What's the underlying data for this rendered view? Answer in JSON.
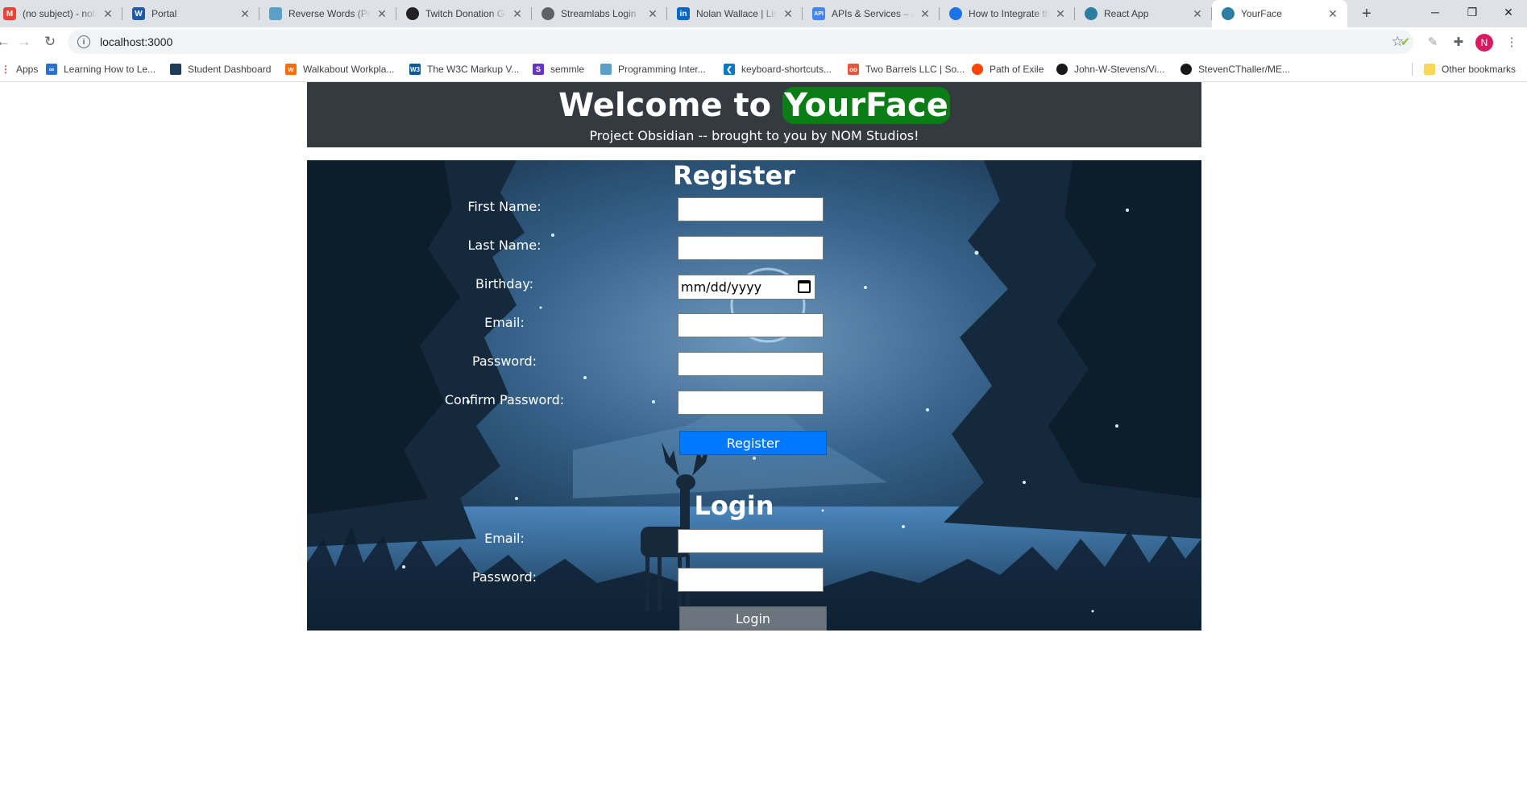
{
  "browser": {
    "tabs": [
      {
        "title": "(no subject) - nolan",
        "favicon": "gmail-icon",
        "color": "#ea4335"
      },
      {
        "title": "Portal",
        "favicon": "portal-w-icon",
        "color": "#1e5aa8"
      },
      {
        "title": "Reverse Words (Pra",
        "favicon": "book-icon",
        "color": "#5aa0c8"
      },
      {
        "title": "Twitch Donation Go",
        "favicon": "streamlabs-icon",
        "color": "#222222"
      },
      {
        "title": "Streamlabs Login",
        "favicon": "globe-icon",
        "color": "#5f6368"
      },
      {
        "title": "Nolan Wallace | Link",
        "favicon": "linkedin-icon",
        "color": "#0a66c2"
      },
      {
        "title": "APIs & Services – Al",
        "favicon": "api-icon",
        "color": "#4285f4"
      },
      {
        "title": "How to Integrate th",
        "favicon": "refresh-blue-icon",
        "color": "#1a73e8"
      },
      {
        "title": "React App",
        "favicon": "react-icon",
        "color": "#2b7ea1"
      },
      {
        "title": "YourFace",
        "favicon": "react-icon",
        "color": "#2b7ea1",
        "active": true
      }
    ],
    "new_tab_label": "+",
    "window_controls": {
      "minimize": "─",
      "restore": "❐",
      "close": "✕"
    },
    "address_bar": {
      "url": "localhost:3000"
    },
    "profile_initial": "N",
    "bookmarks": [
      {
        "label": "Apps",
        "icon": "apps-grid-icon",
        "color": "#ea4335"
      },
      {
        "label": "Learning How to Le...",
        "icon": "coursera-icon",
        "color": "#2a73cc"
      },
      {
        "label": "Student Dashboard",
        "icon": "dashboard-icon",
        "color": "#1f3b5c"
      },
      {
        "label": "Walkabout Workpla...",
        "icon": "walkabout-icon",
        "color": "#ff6d00"
      },
      {
        "label": "The W3C Markup V...",
        "icon": "w3c-icon",
        "color": "#005a9c"
      },
      {
        "label": "semmle",
        "icon": "semmle-icon",
        "color": "#6633cc"
      },
      {
        "label": "Programming Inter...",
        "icon": "book-icon",
        "color": "#5aa0c8"
      },
      {
        "label": "keyboard-shortcuts...",
        "icon": "vscode-icon",
        "color": "#007acc"
      },
      {
        "label": "Two Barrels LLC | So...",
        "icon": "two-barrels-icon",
        "color": "#e8553a"
      },
      {
        "label": "Path of Exile",
        "icon": "reddit-icon",
        "color": "#ff4500"
      },
      {
        "label": "John-W-Stevens/Vi...",
        "icon": "github-icon",
        "color": "#181717"
      },
      {
        "label": "StevenCThaller/ME...",
        "icon": "github-icon",
        "color": "#181717"
      }
    ],
    "other_bookmarks": "Other bookmarks"
  },
  "header": {
    "title_prefix": "Welcome to ",
    "title_brand": "YourFace",
    "subtitle": "Project Obsidian -- brought to you by NOM Studios!"
  },
  "register": {
    "title": "Register",
    "fields": [
      {
        "label": "First Name:",
        "value": ""
      },
      {
        "label": "Last Name:",
        "value": ""
      },
      {
        "label": "Birthday:",
        "placeholder": "mm/dd/yyyy"
      },
      {
        "label": "Email:",
        "value": ""
      },
      {
        "label": "Password:",
        "value": ""
      },
      {
        "label": "Confirm Password:",
        "value": ""
      }
    ],
    "submit_label": "Register"
  },
  "login": {
    "title": "Login",
    "fields": [
      {
        "label": "Email:",
        "value": ""
      },
      {
        "label": "Password:",
        "value": ""
      }
    ],
    "submit_label": "Login"
  },
  "colors": {
    "header_bg": "#343a40",
    "brand_highlight": "#0b7d16",
    "register_button": "#0078ff",
    "login_button": "#6c757d"
  }
}
